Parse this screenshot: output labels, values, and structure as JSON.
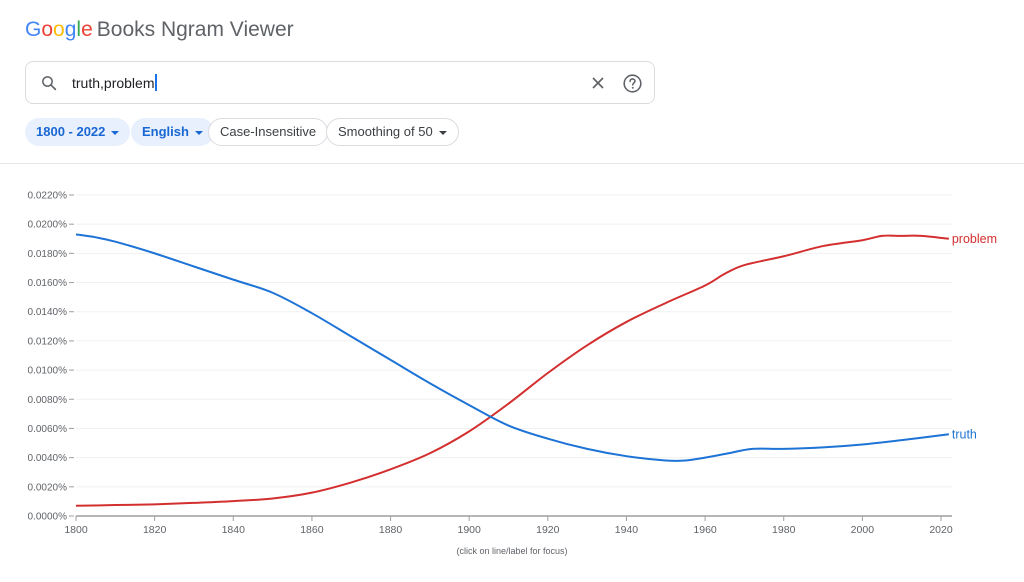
{
  "header": {
    "logo_letters": [
      "G",
      "o",
      "o",
      "g",
      "l",
      "e"
    ],
    "app_title": "Books Ngram Viewer"
  },
  "search": {
    "value": "truth,problem",
    "clear_icon": "close-icon",
    "help_icon": "help-circle-icon",
    "search_icon": "search-icon"
  },
  "filters": {
    "year_range": "1800 - 2022",
    "corpus": "English",
    "case": "Case-Insensitive",
    "smoothing": "Smoothing of 50"
  },
  "footer": {
    "hint": "(click on line/label for focus)"
  },
  "chart_data": {
    "type": "line",
    "title": "",
    "xlabel": "",
    "ylabel": "",
    "xlim": [
      1800,
      2022
    ],
    "ylim": [
      0,
      0.022
    ],
    "x_ticks": [
      1800,
      1820,
      1840,
      1860,
      1880,
      1900,
      1920,
      1940,
      1960,
      1980,
      2000,
      2020
    ],
    "y_ticks": [
      "0.0000%",
      "0.0020%",
      "0.0040%",
      "0.0060%",
      "0.0080%",
      "0.0100%",
      "0.0120%",
      "0.0140%",
      "0.0160%",
      "0.0180%",
      "0.0200%",
      "0.0220%"
    ],
    "y_tick_values": [
      0,
      0.002,
      0.004,
      0.006,
      0.008,
      0.01,
      0.012,
      0.014,
      0.016,
      0.018,
      0.02,
      0.022
    ],
    "grid": true,
    "legend": "line-end labels (right)",
    "series": [
      {
        "name": "problem",
        "color": "#d32f2f",
        "x": [
          1800,
          1810,
          1820,
          1830,
          1840,
          1850,
          1860,
          1870,
          1880,
          1890,
          1900,
          1910,
          1920,
          1930,
          1940,
          1950,
          1960,
          1965,
          1970,
          1980,
          1990,
          2000,
          2005,
          2010,
          2015,
          2022
        ],
        "values": [
          0.0007,
          0.00075,
          0.0008,
          0.0009,
          0.00102,
          0.0012,
          0.0016,
          0.0023,
          0.0032,
          0.0043,
          0.0058,
          0.0077,
          0.0098,
          0.0117,
          0.0133,
          0.0146,
          0.0158,
          0.0166,
          0.0172,
          0.0178,
          0.0185,
          0.0189,
          0.0192,
          0.0192,
          0.0192,
          0.019
        ]
      },
      {
        "name": "truth",
        "color": "#1e73d6",
        "x": [
          1800,
          1805,
          1810,
          1820,
          1830,
          1840,
          1850,
          1860,
          1870,
          1880,
          1890,
          1900,
          1910,
          1920,
          1930,
          1940,
          1950,
          1955,
          1960,
          1966,
          1972,
          1980,
          1990,
          2000,
          2010,
          2022
        ],
        "values": [
          0.0193,
          0.0191,
          0.0188,
          0.018,
          0.0171,
          0.0162,
          0.0153,
          0.0139,
          0.0123,
          0.0107,
          0.0091,
          0.0076,
          0.0062,
          0.0053,
          0.0046,
          0.0041,
          0.0038,
          0.0038,
          0.004,
          0.0043,
          0.0046,
          0.0046,
          0.0047,
          0.0049,
          0.0052,
          0.0056
        ]
      }
    ]
  }
}
